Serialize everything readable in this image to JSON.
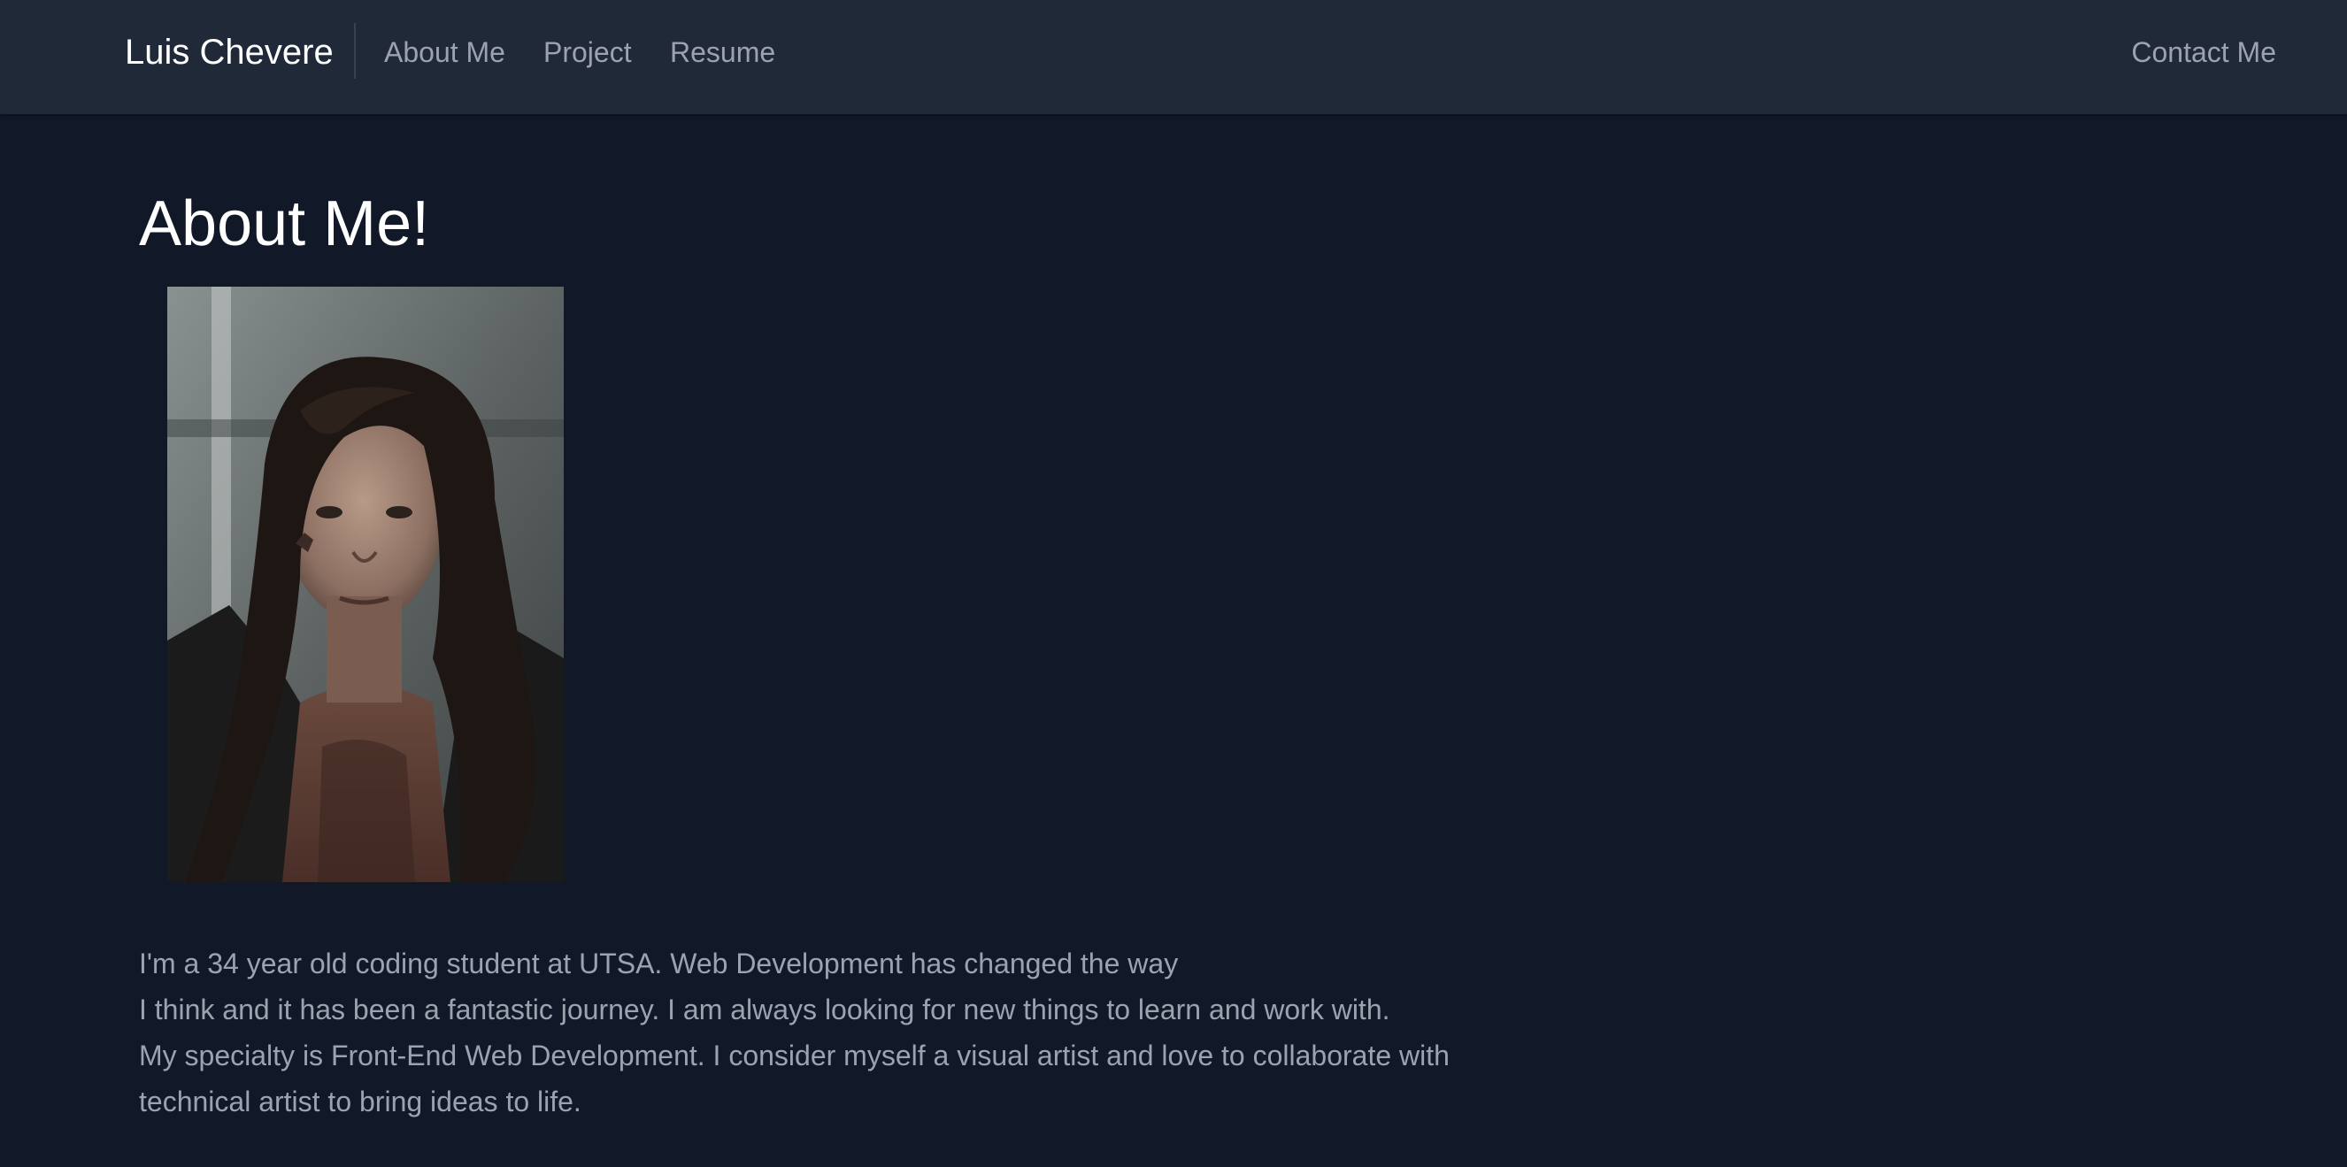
{
  "navbar": {
    "brand": "Luis Chevere",
    "links": [
      {
        "label": "About Me"
      },
      {
        "label": "Project"
      },
      {
        "label": "Resume"
      }
    ],
    "contact_label": "Contact Me"
  },
  "main": {
    "title": "About Me!",
    "bio_lines": [
      "I'm a 34 year old coding student at UTSA. Web Development has changed the way",
      "I think and it has been a fantastic journey. I am always looking for new things to learn and work with.",
      "My specialty is Front-End Web Development. I consider myself a visual artist and love to collaborate with",
      "technical artist to bring ideas to life."
    ]
  },
  "colors": {
    "page_background": "#111827",
    "navbar_background": "#1f2937",
    "text_muted": "#9ca3af",
    "text_bright": "#ffffff"
  }
}
